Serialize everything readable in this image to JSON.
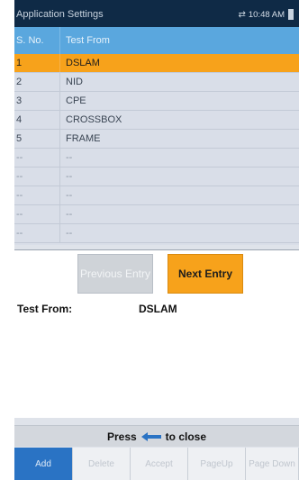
{
  "titlebar": {
    "title": "Application Settings",
    "time": "10:48 AM"
  },
  "table": {
    "headers": [
      "S. No.",
      "Test From"
    ],
    "rows": [
      {
        "sno": "1",
        "value": "DSLAM",
        "selected": true
      },
      {
        "sno": "2",
        "value": "NID"
      },
      {
        "sno": "3",
        "value": "CPE"
      },
      {
        "sno": "4",
        "value": "CROSSBOX"
      },
      {
        "sno": "5",
        "value": "FRAME"
      },
      {
        "sno": "--",
        "value": "--"
      },
      {
        "sno": "--",
        "value": "--"
      },
      {
        "sno": "--",
        "value": "--"
      },
      {
        "sno": "--",
        "value": "--"
      },
      {
        "sno": "--",
        "value": "--"
      }
    ]
  },
  "detail": {
    "previous_label": "Previous Entry",
    "next_label": "Next Entry",
    "test_from_label": "Test From:",
    "test_from_value": "DSLAM"
  },
  "closebar": {
    "prefix": "Press",
    "suffix": "to close"
  },
  "softkeys": [
    "Add",
    "Delete",
    "Accept",
    "PageUp",
    "Page Down"
  ],
  "colors": {
    "titlebar": "#0f2a46",
    "header": "#5aa7de",
    "selected": "#f7a21b",
    "softkey_active": "#2a73c4"
  }
}
